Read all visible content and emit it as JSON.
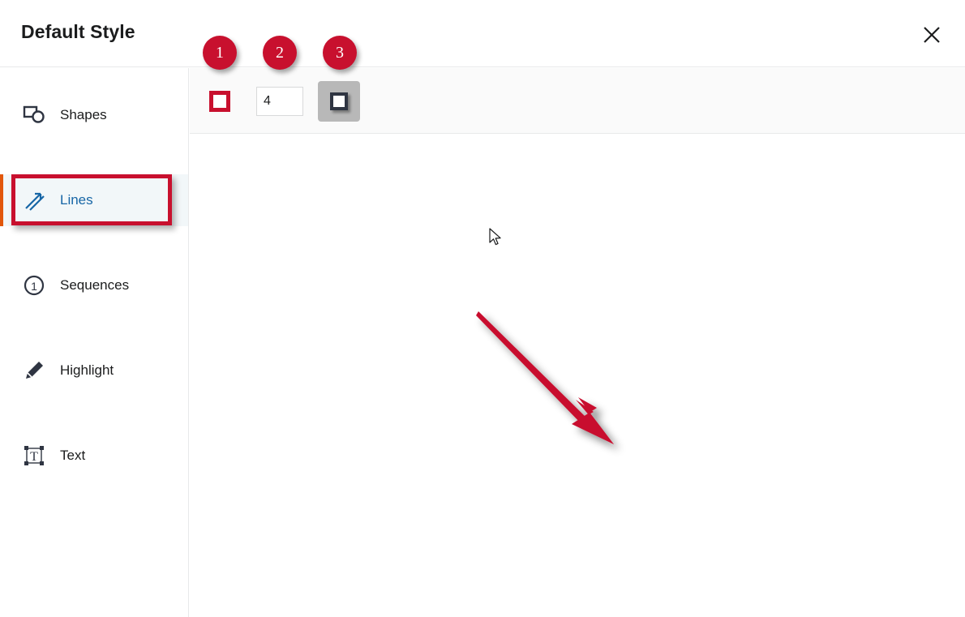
{
  "header": {
    "title": "Default Style",
    "close_label": "close-icon"
  },
  "sidebar": {
    "items": [
      {
        "label": "Shapes",
        "icon": "shapes-icon",
        "selected": false
      },
      {
        "label": "Lines",
        "icon": "lines-icon",
        "selected": true
      },
      {
        "label": "Sequences",
        "icon": "sequences-icon",
        "selected": false
      },
      {
        "label": "Highlight",
        "icon": "highlight-icon",
        "selected": false
      },
      {
        "label": "Text",
        "icon": "text-icon",
        "selected": false
      }
    ]
  },
  "toolbar": {
    "color_swatch": {
      "name": "line-color-swatch",
      "color": "#c8102e"
    },
    "line_width": {
      "name": "line-width-input",
      "value": "4",
      "placeholder": "4"
    },
    "shadow_toggle": {
      "name": "shadow-toggle-button",
      "state": "active"
    }
  },
  "canvas": {
    "arrow": {
      "name": "red-arrow-annotation",
      "color": "#c8102e",
      "start": "590,384",
      "end": "757,548"
    },
    "cursor": {
      "name": "mouse-cursor",
      "position": "605,283"
    }
  },
  "annotations": {
    "badges": [
      {
        "label": "1",
        "target": "line-color-swatch"
      },
      {
        "label": "2",
        "target": "line-width-input"
      },
      {
        "label": "3",
        "target": "shadow-toggle-button"
      }
    ],
    "highlight_box": {
      "name": "lines-highlight-box",
      "target": "sidebar-item-lines",
      "color": "#c8102e"
    }
  },
  "colors": {
    "accent_red": "#c8102e",
    "selected_text": "#1766a6",
    "selected_bg": "#f2f7f9",
    "selected_bar": "#e2570c",
    "icon_dark": "#2f3542",
    "toolbar_bg": "#fafafa",
    "border": "#e8e9ea"
  }
}
